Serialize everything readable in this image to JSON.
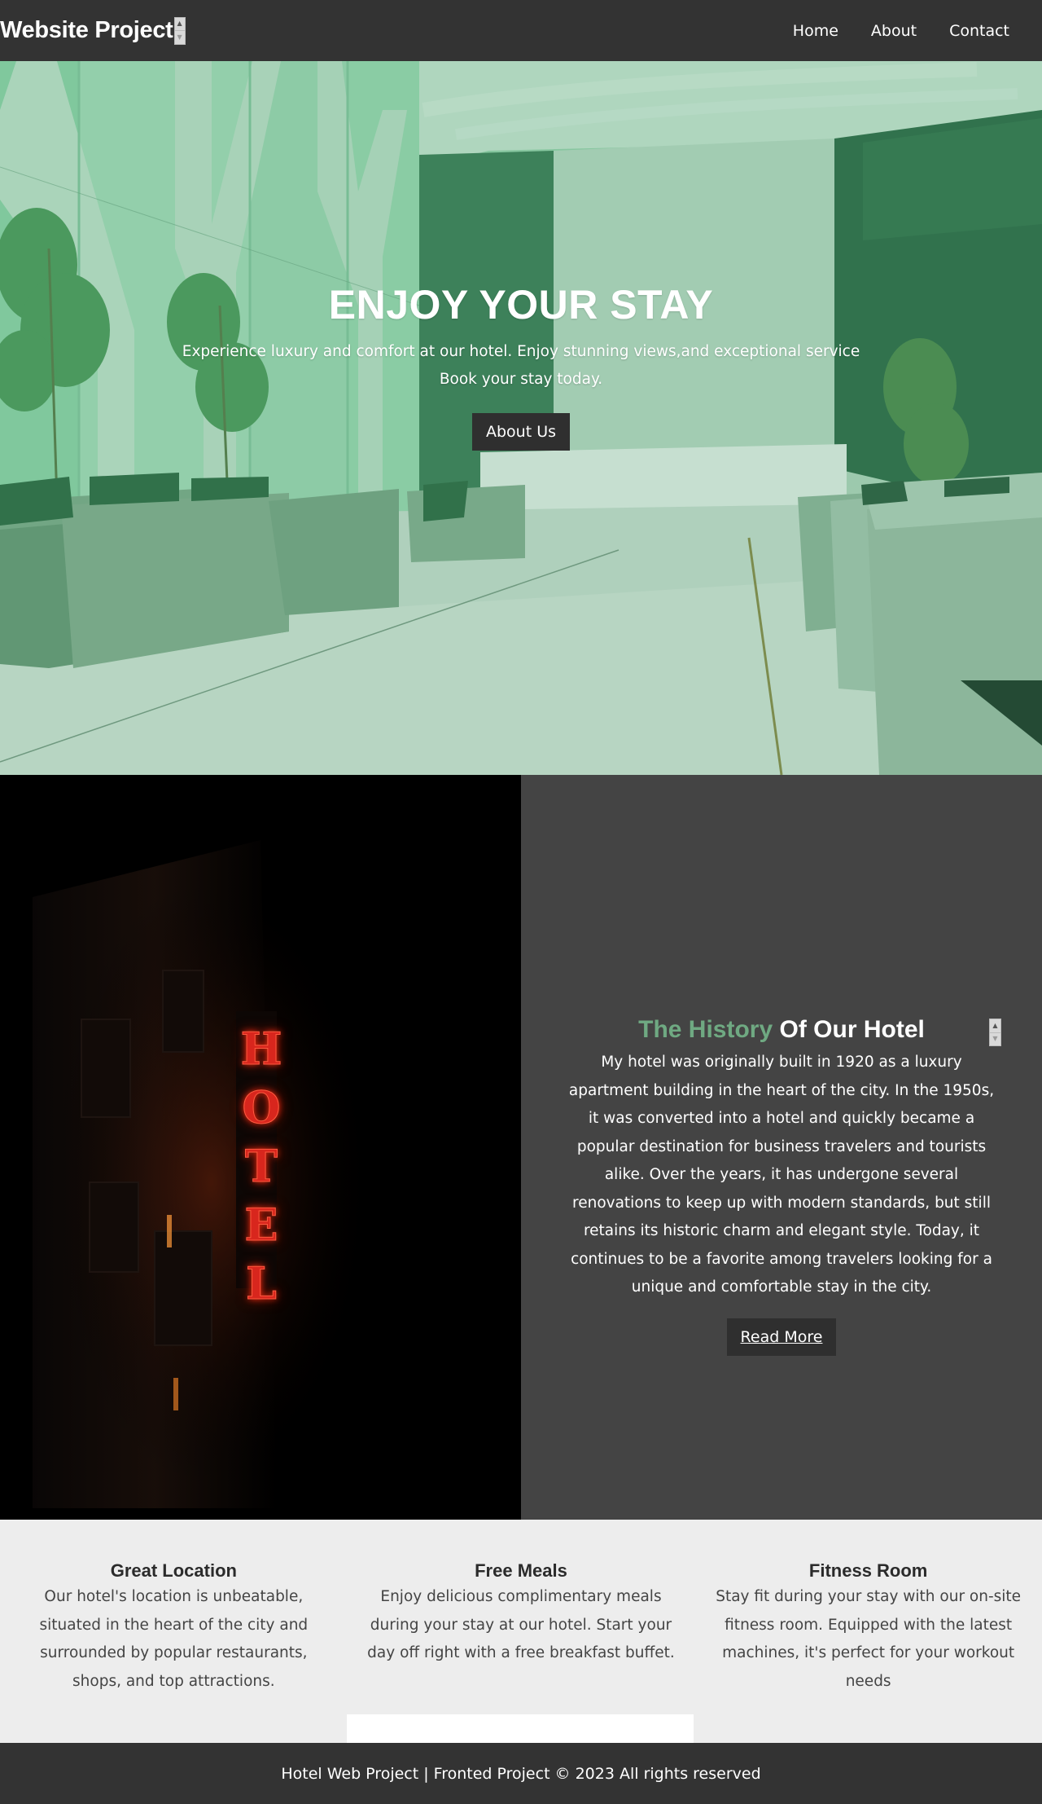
{
  "navbar": {
    "brand": "Website Project",
    "links": [
      "Home",
      "About",
      "Contact"
    ]
  },
  "hero": {
    "title": "ENJOY YOUR STAY",
    "text_line1": "Experience luxury and comfort at our hotel. Enjoy stunning views,and exceptional service",
    "text_line2": "Book your stay today.",
    "button": "About Us"
  },
  "history": {
    "title_accent": "The History",
    "title_rest": "Of Our Hotel",
    "text": "My hotel was originally built in 1920 as a luxury apartment building in the heart of the city. In the 1950s, it was converted into a hotel and quickly became a popular destination for business travelers and tourists alike. Over the years, it has undergone several renovations to keep up with modern standards, but still retains its historic charm and elegant style. Today, it continues to be a favorite among travelers looking for a unique and comfortable stay in the city.",
    "button": "Read More",
    "sign_letters": [
      "H",
      "O",
      "T",
      "E",
      "L"
    ]
  },
  "features": [
    {
      "title": "Great Location",
      "text": "Our hotel's location is unbeatable, situated in the heart of the city and surrounded by popular restaurants, shops, and top attractions."
    },
    {
      "title": "Free Meals",
      "text": "Enjoy delicious complimentary meals during your stay at our hotel. Start your day off right with a free breakfast buffet."
    },
    {
      "title": "Fitness Room",
      "text": "Stay fit during your stay with our on-site fitness room. Equipped with the latest machines, it's perfect for your workout needs"
    }
  ],
  "footer": {
    "text": "Hotel Web Project | Fronted Project © 2023 All rights reserved"
  },
  "colors": {
    "nav_bg": "#333333",
    "history_bg": "#444444",
    "accent_green": "#6fa982",
    "sign_red": "#e0241f",
    "features_bg": "#ededed"
  },
  "icons": {
    "spinner": "number-spinner-icon"
  }
}
